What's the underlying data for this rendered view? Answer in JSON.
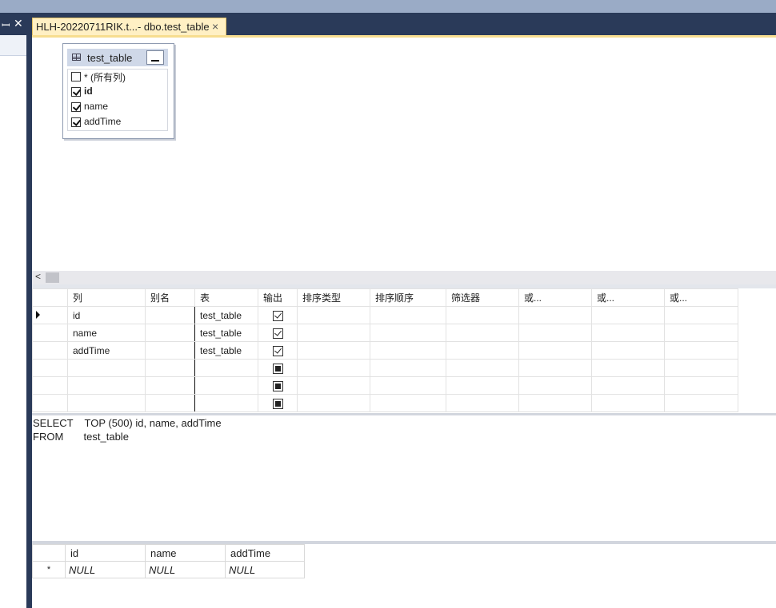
{
  "tab": {
    "title": "HLH-20220711RIK.t...- dbo.test_table",
    "close": "×"
  },
  "side": {
    "pin": "ꟷ",
    "close": "✕"
  },
  "diagram": {
    "table_name": "test_table",
    "columns": [
      {
        "label": "* (所有列)",
        "checked": false,
        "bold": false
      },
      {
        "label": "id",
        "checked": true,
        "bold": true
      },
      {
        "label": "name",
        "checked": true,
        "bold": false
      },
      {
        "label": "addTime",
        "checked": true,
        "bold": false
      }
    ]
  },
  "scroll": {
    "left_arrow": "<"
  },
  "criteria": {
    "headers": [
      "列",
      "别名",
      "表",
      "输出",
      "排序类型",
      "排序顺序",
      "筛选器",
      "或...",
      "或...",
      "或..."
    ],
    "rows": [
      {
        "column": "id",
        "alias": "",
        "table": "test_table",
        "output": "checked"
      },
      {
        "column": "name",
        "alias": "",
        "table": "test_table",
        "output": "checked"
      },
      {
        "column": "addTime",
        "alias": "",
        "table": "test_table",
        "output": "checked"
      },
      {
        "column": "",
        "alias": "",
        "table": "",
        "output": "indeterminate"
      },
      {
        "column": "",
        "alias": "",
        "table": "",
        "output": "indeterminate"
      },
      {
        "column": "",
        "alias": "",
        "table": "",
        "output": "indeterminate"
      }
    ]
  },
  "sql": {
    "line1": "SELECT    TOP (500) id, name, addTime",
    "line2": "FROM       test_table"
  },
  "results": {
    "headers": [
      "id",
      "name",
      "addTime"
    ],
    "new_row_marker": "*",
    "null_row": [
      "NULL",
      "NULL",
      "NULL"
    ]
  }
}
